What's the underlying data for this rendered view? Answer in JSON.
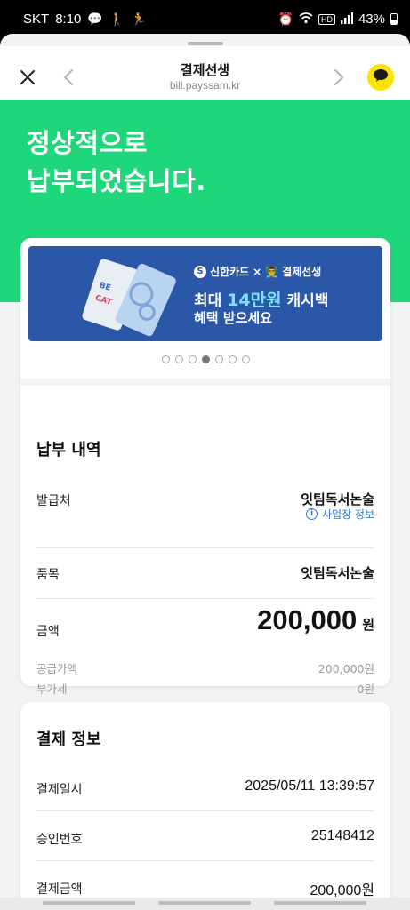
{
  "status_bar": {
    "carrier": "SKT",
    "time": "8:10",
    "battery": "43%",
    "hd_label": "HD"
  },
  "nav": {
    "title": "결제선생",
    "url": "bill.payssam.kr"
  },
  "hero": {
    "line1": "정상적으로",
    "line2": "납부되었습니다."
  },
  "banner": {
    "brand_card": "신한카드",
    "brand_x": "×",
    "brand_partner": "결제선생",
    "line1_prefix": "최대",
    "line1_highlight": "14만원",
    "line1_suffix": "캐시백",
    "line2": "혜택 받으세요",
    "dots_total": 7,
    "dots_active_index": 3
  },
  "payment_details": {
    "title": "납부 내역",
    "issuer_label": "발급처",
    "issuer_value": "잇팀독서논술",
    "business_info_link": "사업장 정보",
    "item_label": "품목",
    "item_value": "잇팀독서논술",
    "amount_label": "금액",
    "amount_value": "200,000",
    "amount_unit": "원",
    "supply_label": "공급가액",
    "supply_value": "200,000원",
    "vat_label": "부가세",
    "vat_value": "0원"
  },
  "payment_info": {
    "title": "결제 정보",
    "datetime_label": "결제일시",
    "datetime_value": "2025/05/11 13:39:57",
    "approval_label": "승인번호",
    "approval_value": "25148412",
    "paid_amount_label": "결제금액",
    "paid_amount_value": "200,000원"
  },
  "colors": {
    "accent_green": "#1ed77a",
    "kakao_yellow": "#fde300",
    "banner_blue": "#2b57a8",
    "link_blue": "#2f7bd6"
  },
  "icons": {
    "close": "close-icon",
    "back": "chevron-left-icon",
    "forward": "chevron-right-icon",
    "chat": "kakao-chat-icon",
    "info": "info-icon"
  }
}
